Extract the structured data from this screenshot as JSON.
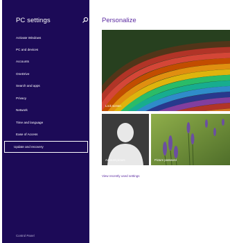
{
  "sidebar": {
    "title": "PC settings",
    "items": [
      {
        "label": "Activate Windows"
      },
      {
        "label": "PC and devices"
      },
      {
        "label": "Accounts"
      },
      {
        "label": "OneDrive"
      },
      {
        "label": "Search and apps"
      },
      {
        "label": "Privacy"
      },
      {
        "label": "Network"
      },
      {
        "label": "Time and language"
      },
      {
        "label": "Ease of Access"
      }
    ],
    "selected_item": "Update and recovery",
    "footer": "Control Panel"
  },
  "main": {
    "title": "Personalize",
    "tiles": {
      "lock_screen": "Lock screen",
      "account_picture": "Account picture",
      "picture_password": "Picture password"
    },
    "recent_link": "View recently used settings"
  },
  "colors": {
    "sidebar_bg": "#1c0a57",
    "accent": "#5b2aa0"
  },
  "icons": {
    "search": "search-icon"
  }
}
